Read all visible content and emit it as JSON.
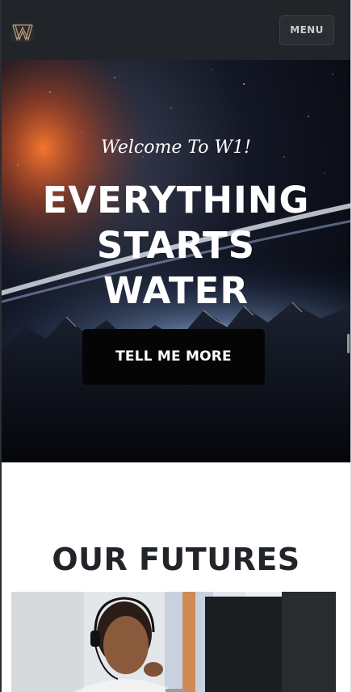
{
  "navbar": {
    "menu_label": "MENU",
    "logo_icon": "w1-monogram-logo"
  },
  "hero": {
    "welcome": "Welcome To W1!",
    "headline_lines": [
      "EVERYTHING",
      "STARTS",
      "WATER"
    ],
    "cta_label": "TELL ME MORE",
    "background": "space-planet-horizon-image"
  },
  "section": {
    "title": "OUR FUTURES",
    "image": "student-with-headset-at-computer-photo"
  },
  "colors": {
    "navbar_bg": "#212529",
    "cta_bg": "#050505",
    "title_text": "#212529",
    "hero_text": "#ffffff"
  }
}
